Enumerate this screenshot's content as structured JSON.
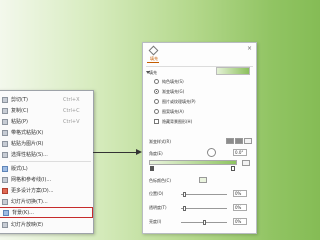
{
  "context_menu": {
    "items": [
      {
        "label": "剪切(T)",
        "shortcut": "Ctrl+X"
      },
      {
        "label": "复制(C)",
        "shortcut": "Ctrl+C"
      },
      {
        "label": "粘贴(P)",
        "shortcut": "Ctrl+V"
      },
      {
        "label": "带格式粘贴(K)",
        "shortcut": ""
      },
      {
        "label": "粘贴为图片(R)",
        "shortcut": ""
      },
      {
        "label": "选择性粘贴(S)...",
        "shortcut": ""
      },
      {
        "label": "版式(L)",
        "shortcut": ""
      },
      {
        "label": "网格和参考线(I)...",
        "shortcut": ""
      },
      {
        "label": "更多设计方案(D)...",
        "shortcut": ""
      },
      {
        "label": "幻灯片切换(T)...",
        "shortcut": ""
      },
      {
        "label": "背景(K)...",
        "shortcut": ""
      },
      {
        "label": "幻灯片放映(E)",
        "shortcut": ""
      }
    ]
  },
  "pane": {
    "tab": "填充",
    "close": "×",
    "section": "填充",
    "options": [
      {
        "label": "纯色填充(S)",
        "selected": false
      },
      {
        "label": "渐变填充(G)",
        "selected": true
      },
      {
        "label": "图片或纹理填充(P)",
        "selected": false
      },
      {
        "label": "图案填充(A)",
        "selected": false
      }
    ],
    "hide_graphics_label": "隐藏背景图形(H)",
    "gradient_style_label": "渐变样式(R)",
    "angle_label": "角度(E)",
    "angle_value": "0.0°",
    "color_label": "色标颜色(C)",
    "position_label": "位置(O)",
    "position_value": "0%",
    "transparency_label": "透明度(T)",
    "transparency_value": "0%",
    "brightness_label": "亮度(I)",
    "brightness_value": "0%",
    "colors": {
      "accent": "#c45c00",
      "gradient_start": "#eaf4de",
      "gradient_end": "#8ec460"
    }
  }
}
